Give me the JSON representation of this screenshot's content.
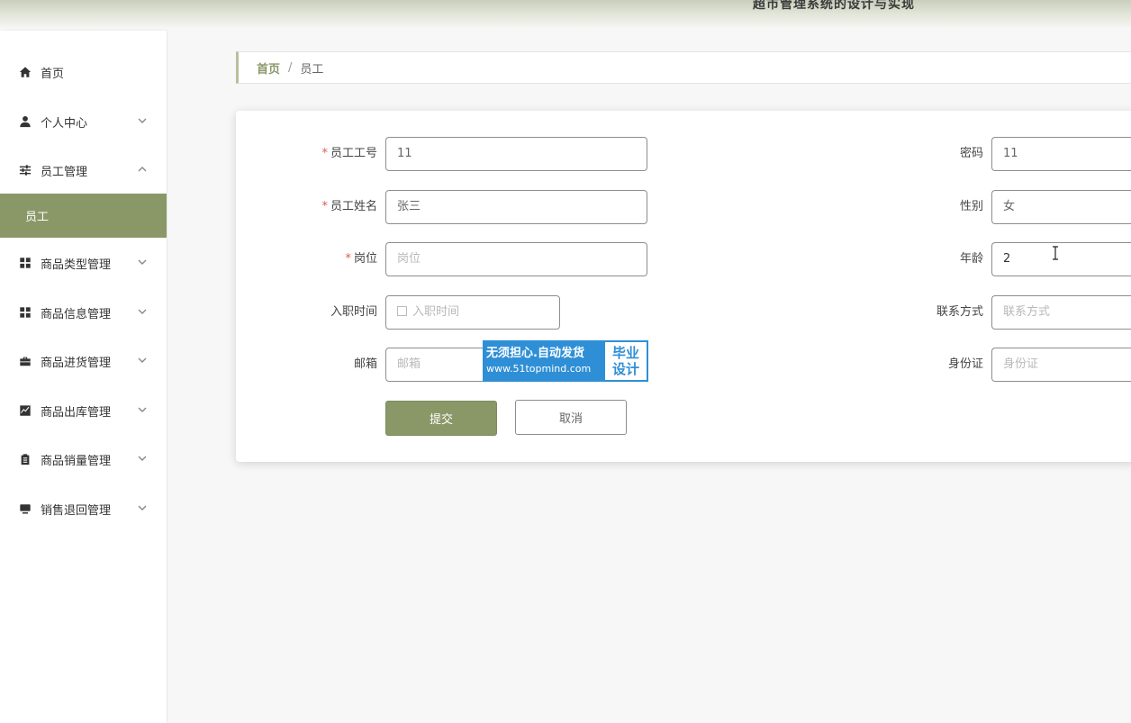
{
  "header": {
    "site_title": "超市管理系统的设计与实现"
  },
  "sidebar": {
    "items": [
      {
        "label": "首页",
        "icon": "home-icon"
      },
      {
        "label": "个人中心",
        "icon": "user-icon"
      },
      {
        "label": "员工管理",
        "icon": "sliders-icon",
        "expanded": true
      },
      {
        "label": "员工",
        "active": true
      },
      {
        "label": "商品类型管理",
        "icon": "grid-icon"
      },
      {
        "label": "商品信息管理",
        "icon": "grid-icon"
      },
      {
        "label": "商品进货管理",
        "icon": "briefcase-icon"
      },
      {
        "label": "商品出库管理",
        "icon": "chart-icon"
      },
      {
        "label": "商品销量管理",
        "icon": "clipboard-icon"
      },
      {
        "label": "销售退回管理",
        "icon": "monitor-icon"
      }
    ]
  },
  "breadcrumb": {
    "home": "首页",
    "separator": "/",
    "current": "员工"
  },
  "form": {
    "employee_no": {
      "label": "员工工号",
      "value": "11",
      "required": true
    },
    "employee_name": {
      "label": "员工姓名",
      "value": "张三",
      "required": true
    },
    "position": {
      "label": "岗位",
      "placeholder": "岗位",
      "required": true
    },
    "hire_date": {
      "label": "入职时间",
      "placeholder": "入职时间"
    },
    "email": {
      "label": "邮箱",
      "placeholder": "邮箱"
    },
    "password": {
      "label": "密码",
      "value": "11"
    },
    "gender": {
      "label": "性别",
      "value": "女"
    },
    "age": {
      "label": "年龄",
      "value": "2"
    },
    "contact": {
      "label": "联系方式",
      "placeholder": "联系方式"
    },
    "id_card": {
      "label": "身份证",
      "placeholder": "身份证"
    },
    "required_mark": "*",
    "submit_label": "提交",
    "cancel_label": "取消"
  },
  "watermark": {
    "line1": "无须担心.自动发货",
    "line2": "www.51topmind.com",
    "badge_top": "毕业",
    "badge_bottom": "设计"
  },
  "colors": {
    "accent": "#8a9868",
    "required": "#e05a4e",
    "watermark_blue": "#2f8fd6"
  }
}
